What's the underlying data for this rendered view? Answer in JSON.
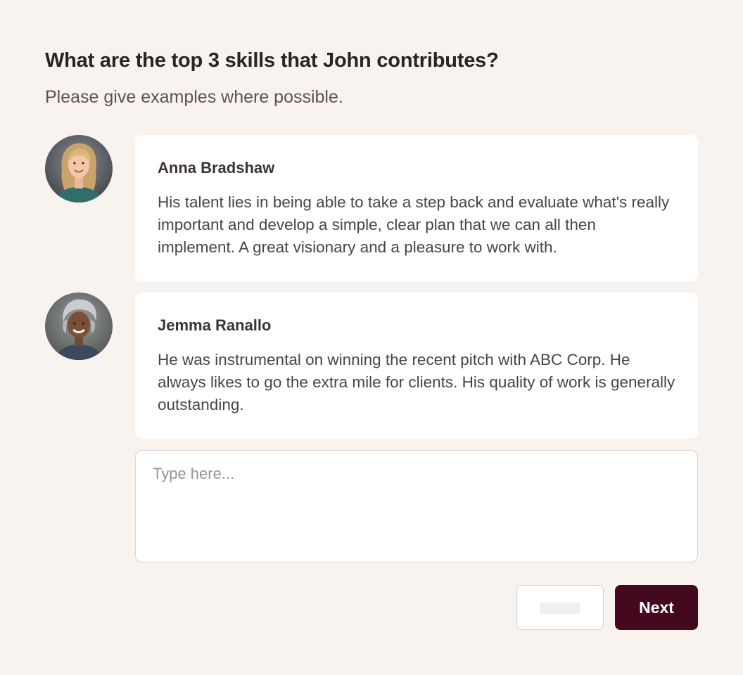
{
  "question": {
    "title": "What are the top 3 skills that John contributes?",
    "subtitle": "Please give examples where possible."
  },
  "responses": [
    {
      "author": "Anna Bradshaw",
      "text": "His talent lies in being able to take a step back and evaluate what's really important and develop a simple, clear plan that we can all then implement. A great visionary and a pleasure to work with.",
      "avatar": "woman-blonde-avatar"
    },
    {
      "author": "Jemma Ranallo",
      "text": "He was instrumental on winning the recent pitch with ABC Corp. He always likes to go the extra mile for clients. His quality of work is generally outstanding.",
      "avatar": "woman-grey-hair-avatar"
    }
  ],
  "answer": {
    "placeholder": "Type here...",
    "value": ""
  },
  "actions": {
    "back_label": "",
    "next_label": "Next"
  },
  "colors": {
    "background": "#f8f3ef",
    "card": "#ffffff",
    "primary_button": "#44081f"
  }
}
